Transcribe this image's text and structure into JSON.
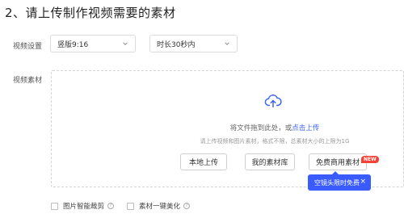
{
  "section": {
    "title": "2、请上传制作视频需要的素材"
  },
  "settings": {
    "label": "视频设置",
    "orientation_value": "竖版9:16",
    "duration_value": "时长30秒内"
  },
  "material": {
    "label": "视频素材",
    "hint_prefix": "将文件拖到此处，或",
    "hint_link": "点击上传",
    "subhint": "请上传视频和图片素材，格式不限，总素材大小的上限为1G"
  },
  "buttons": {
    "local_upload": "本地上传",
    "my_library": "我的素材库",
    "free_commercial": "免费商用素材",
    "new_badge": "NEW"
  },
  "tooltip": {
    "text": "空镜头限时免费",
    "close": "×"
  },
  "options": {
    "smart_crop": "图片智能裁剪",
    "beautify": "素材一键美化"
  },
  "colors": {
    "accent": "#3a5bff",
    "badge": "#f44336"
  }
}
